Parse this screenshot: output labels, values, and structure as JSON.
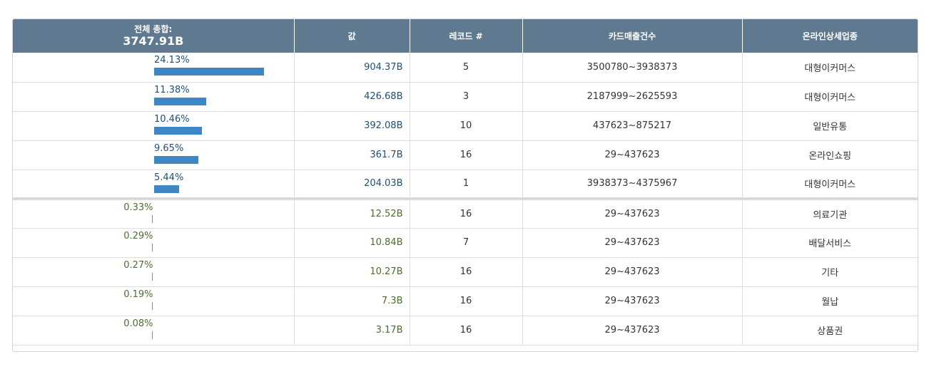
{
  "chart_data": {
    "type": "table",
    "header": {
      "total_label": "전체 총합:",
      "total_value": "3747.91B",
      "col_value": "값",
      "col_records": "레코드 #",
      "col_card_sales": "카드매출건수",
      "col_industry": "온라인상세업종"
    },
    "rows": [
      {
        "pct_label": "24.13%",
        "pct": 24.13,
        "value": "904.37B",
        "records": "5",
        "card_sales": "3500780~3938373",
        "industry": "대형이커머스"
      },
      {
        "pct_label": "11.38%",
        "pct": 11.38,
        "value": "426.68B",
        "records": "3",
        "card_sales": "2187999~2625593",
        "industry": "대형이커머스"
      },
      {
        "pct_label": "10.46%",
        "pct": 10.46,
        "value": "392.08B",
        "records": "10",
        "card_sales": "437623~875217",
        "industry": "일반유통"
      },
      {
        "pct_label": "9.65%",
        "pct": 9.65,
        "value": "361.7B",
        "records": "16",
        "card_sales": "29~437623",
        "industry": "온라인쇼핑"
      },
      {
        "pct_label": "5.44%",
        "pct": 5.44,
        "value": "204.03B",
        "records": "1",
        "card_sales": "3938373~4375967",
        "industry": "대형이커머스"
      },
      {
        "pct_label": "0.33%",
        "pct": 0.33,
        "value": "12.52B",
        "records": "16",
        "card_sales": "29~437623",
        "industry": "의료기관"
      },
      {
        "pct_label": "0.29%",
        "pct": 0.29,
        "value": "10.84B",
        "records": "7",
        "card_sales": "29~437623",
        "industry": "배달서비스"
      },
      {
        "pct_label": "0.27%",
        "pct": 0.27,
        "value": "10.27B",
        "records": "16",
        "card_sales": "29~437623",
        "industry": "기타"
      },
      {
        "pct_label": "0.19%",
        "pct": 0.19,
        "value": "7.3B",
        "records": "16",
        "card_sales": "29~437623",
        "industry": "월납"
      },
      {
        "pct_label": "0.08%",
        "pct": 0.08,
        "value": "3.17B",
        "records": "16",
        "card_sales": "29~437623",
        "industry": "상품권"
      }
    ],
    "top_group_size": 5
  },
  "colors": {
    "header_bg": "#5f7a90",
    "bar": "#3e87c4",
    "top_value_text": "#1f4e79",
    "rest_value_text": "#4a6e2c"
  }
}
